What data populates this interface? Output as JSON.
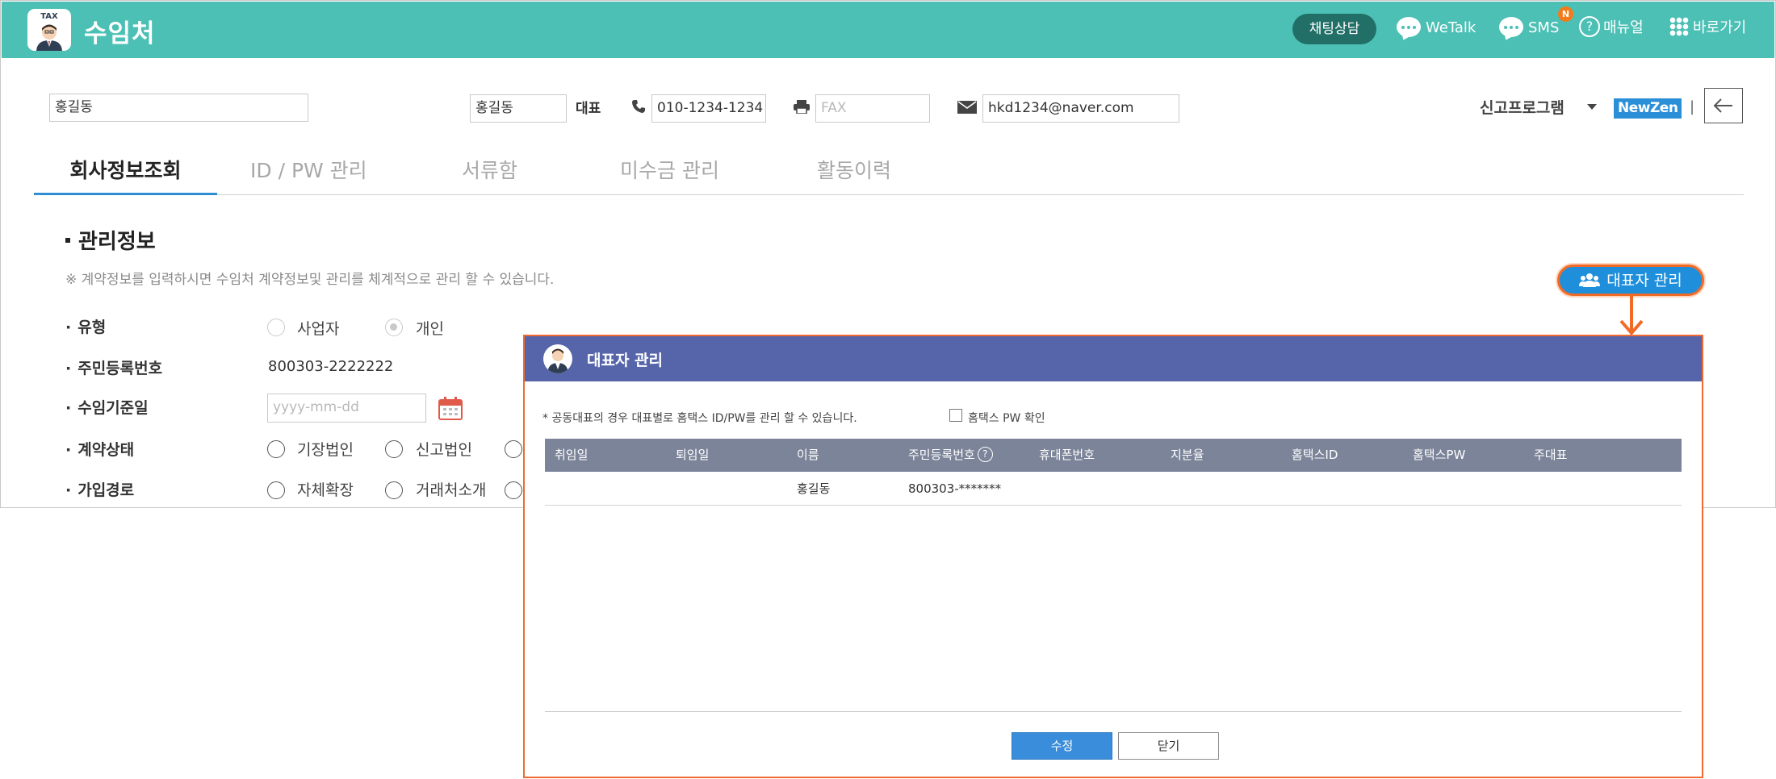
{
  "header": {
    "logo_text": "TAX",
    "title": "수임처",
    "chat_button": "채팅상담",
    "wetalk": "WeTalk",
    "sms": "SMS",
    "sms_badge": "N",
    "manual": "매뉴얼",
    "shortcut": "바로가기"
  },
  "info": {
    "company_name": "홍길동",
    "ceo_name": "홍길동",
    "ceo_label": "대표",
    "phone": "010-1234-1234",
    "fax_placeholder": "FAX",
    "email": "hkd1234@naver.com",
    "program_label": "신고프로그램",
    "program_logo": "NewZen",
    "separator": "|"
  },
  "tabs": [
    {
      "label": "회사정보조회",
      "active": true
    },
    {
      "label": "ID / PW 관리",
      "active": false
    },
    {
      "label": "서류함",
      "active": false
    },
    {
      "label": "미수금 관리",
      "active": false
    },
    {
      "label": "활동이력",
      "active": false
    }
  ],
  "management": {
    "title": "관리정보",
    "notice": "※ 계약정보를 입력하시면 수임처 계약정보및 관리를 체계적으로 관리 할 수 있습니다.",
    "manage_ceo_button": "대표자 관리",
    "rows": {
      "type_label": "유형",
      "type_options": [
        "사업자",
        "개인"
      ],
      "type_selected": "개인",
      "rrn_label": "주민등록번호",
      "rrn_value": "800303-2222222",
      "start_date_label": "수임기준일",
      "start_date_placeholder": "yyyy-mm-dd",
      "contract_label": "계약상태",
      "contract_options": [
        "기장법인",
        "신고법인"
      ],
      "join_label": "가입경로",
      "join_options": [
        "자체확장",
        "거래처소개"
      ]
    }
  },
  "modal": {
    "title": "대표자 관리",
    "notice": "* 공동대표의 경우 대표별로 홈택스 ID/PW를 관리 할 수 있습니다.",
    "checkbox_label": "홈택스 PW 확인",
    "columns": [
      "취임일",
      "퇴임일",
      "이름",
      "주민등록번호",
      "휴대폰번호",
      "지분율",
      "홈택스ID",
      "홈택스PW",
      "주대표"
    ],
    "rows": [
      {
        "start": "",
        "end": "",
        "name": "홍길동",
        "rrn": "800303-*******",
        "mobile": "",
        "share": "",
        "hometax_id": "",
        "hometax_pw": "",
        "main": ""
      }
    ],
    "save_button": "수정",
    "close_button": "닫기"
  },
  "colors": {
    "header_bg": "#4cc0b5",
    "chat_button_bg": "#216f66",
    "accent_blue": "#2f8fd4",
    "highlight_orange": "#f26b26",
    "modal_header_bg": "#5665aa",
    "table_header_bg": "#7c8499"
  }
}
